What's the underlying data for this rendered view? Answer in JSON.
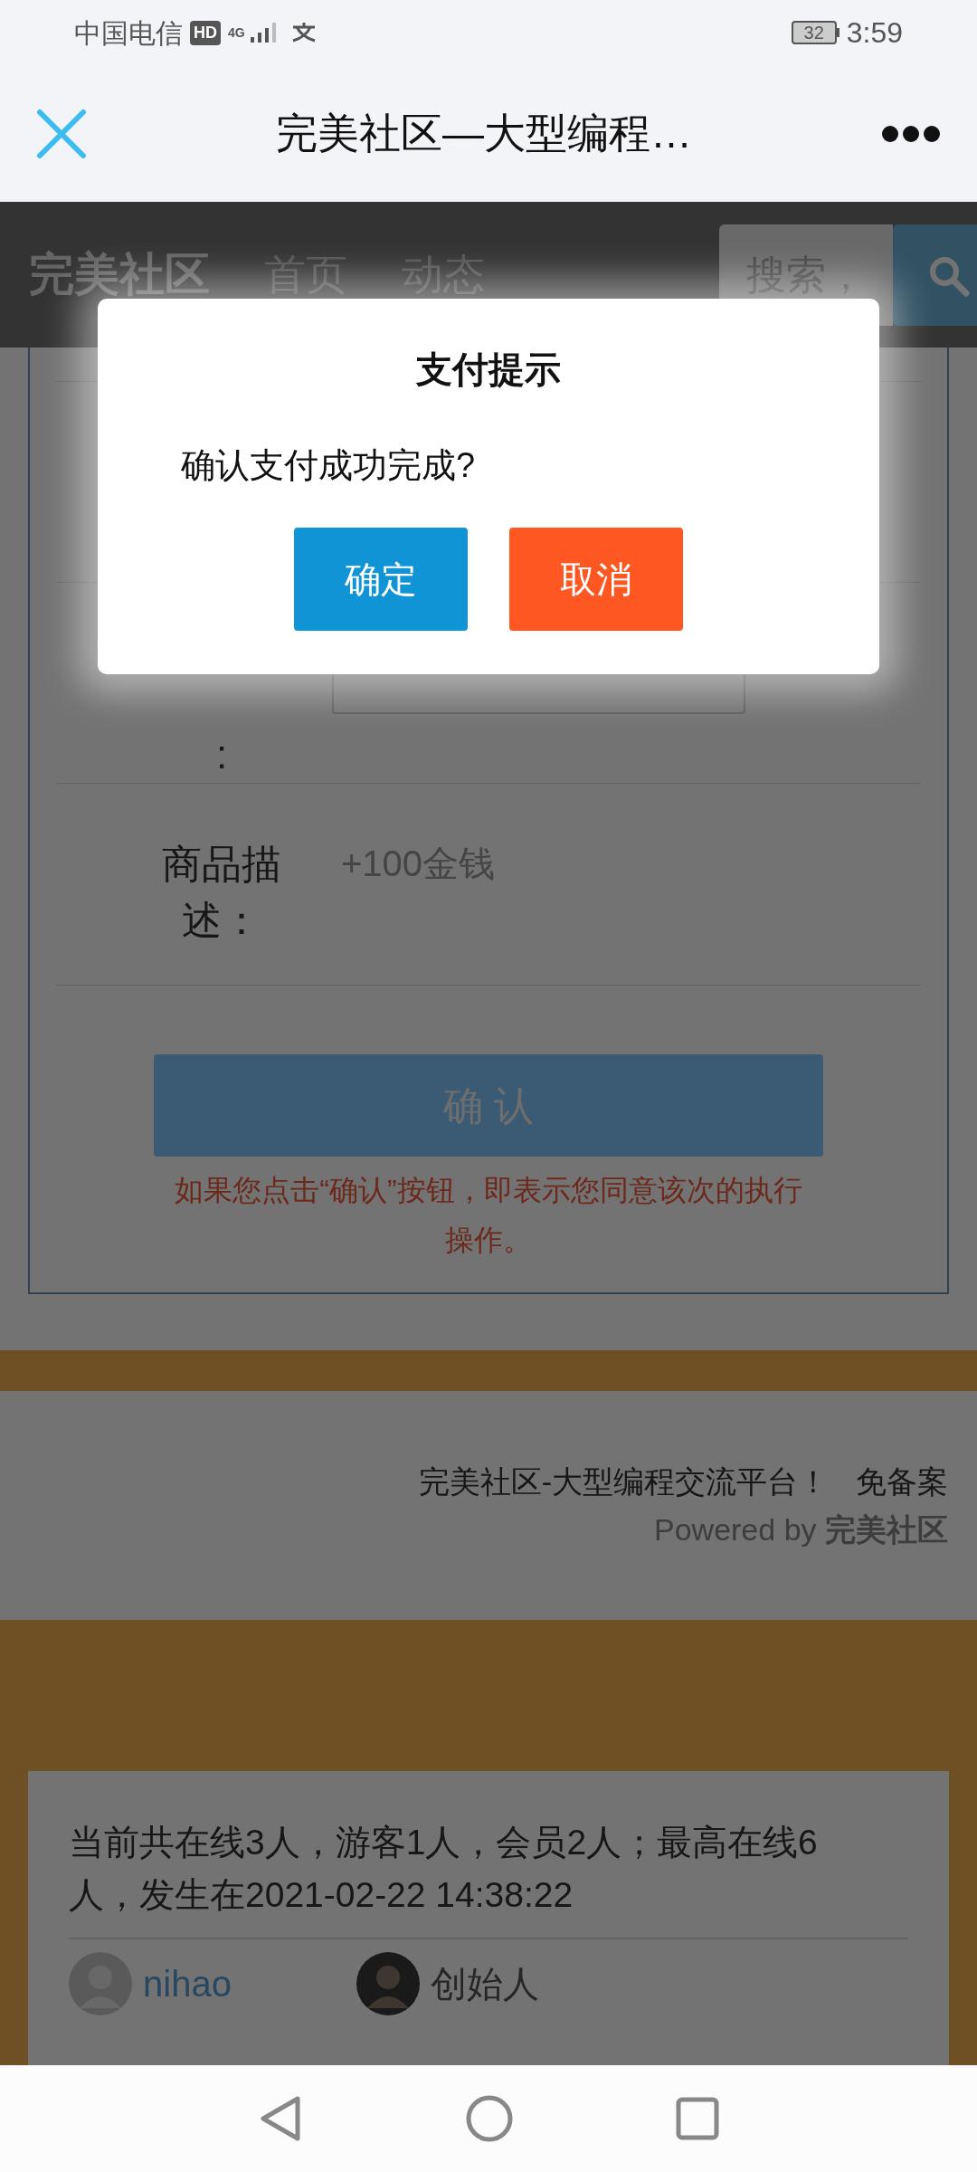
{
  "status_bar": {
    "carrier": "中国电信",
    "hd": "HD",
    "network": "4G",
    "battery": "32",
    "time": "3:59"
  },
  "title_bar": {
    "title": "完美社区—大型编程…"
  },
  "site_nav": {
    "logo": "完美社区",
    "links": [
      "首页",
      "动态"
    ],
    "search": {
      "placeholder": "搜索，"
    }
  },
  "form": {
    "amount_label_tail": ":",
    "description": {
      "label": "商品描述：",
      "value": "+100金钱"
    },
    "submit": "确 认",
    "notice": "如果您点击“确认”按钮，即表示您同意该次的执行操作。"
  },
  "footer": {
    "slogan": "完美社区-大型编程交流平台！",
    "icp": "免备案",
    "powered": "Powered by **完美社区**"
  },
  "online": {
    "summary": "当前共在线3人，游客1人，会员2人；最高在线6人，发生在2021-02-22 14:38:22",
    "users": [
      {
        "name": "nihao",
        "kind": "link"
      },
      {
        "name": "创始人",
        "kind": "plain"
      }
    ]
  },
  "dialog": {
    "title": "支付提示",
    "message": "确认支付成功完成?",
    "buttons": [
      {
        "label": "确定",
        "kind": "primary"
      },
      {
        "label": "取消",
        "kind": "danger"
      }
    ]
  }
}
